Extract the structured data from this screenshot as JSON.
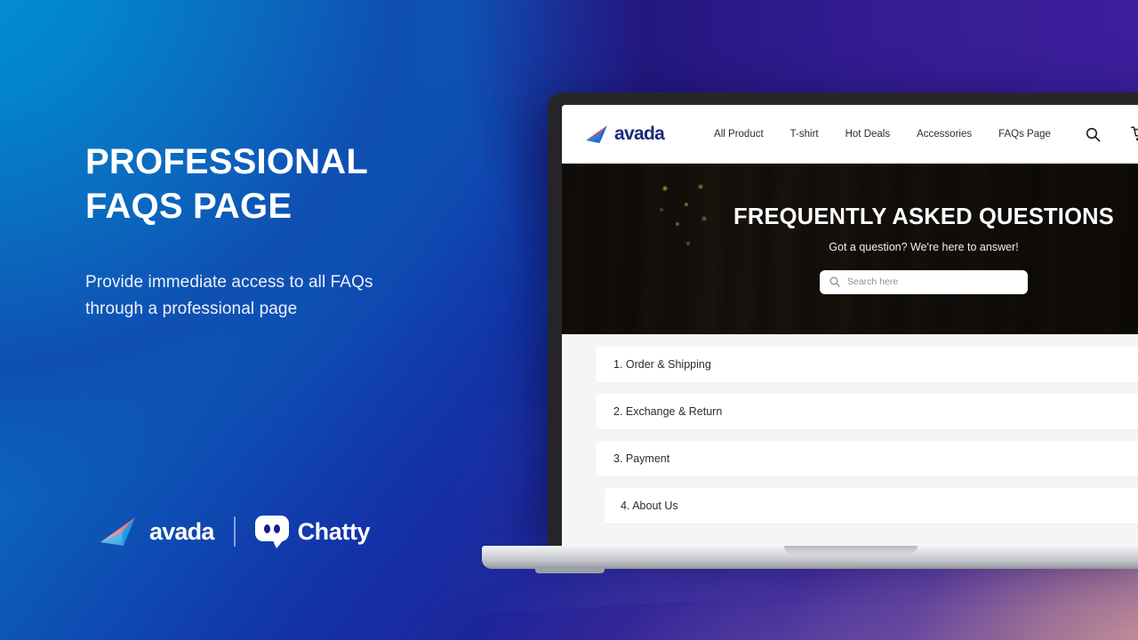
{
  "promo": {
    "headline_line1": "PROFESSIONAL",
    "headline_line2": "FAQs PAGE",
    "subcopy_line1": "Provide immediate access to all FAQs",
    "subcopy_line2": "through a professional page"
  },
  "brands": [
    {
      "name": "avada",
      "mark": "avada-dart-icon"
    },
    {
      "name": "Chatty",
      "mark": "chatty-bubble-icon"
    }
  ],
  "browser": {
    "nav": {
      "logo_text": "avada",
      "links": [
        {
          "label": "All Product"
        },
        {
          "label": "T-shirt"
        },
        {
          "label": "Hot Deals"
        },
        {
          "label": "Accessories"
        },
        {
          "label": "FAQs Page"
        }
      ],
      "icons": [
        {
          "name": "search-icon"
        },
        {
          "name": "cart-icon"
        }
      ]
    },
    "hero": {
      "title": "FREQUENTLY ASKED QUESTIONS",
      "subtitle": "Got a question? We're here to answer!",
      "search_placeholder": "Search here",
      "search_value": ""
    },
    "faqs": [
      {
        "label": "1. Order & Shipping"
      },
      {
        "label": "2. Exchange & Return"
      },
      {
        "label": "3. Payment"
      },
      {
        "label": "4. About Us"
      }
    ]
  },
  "colors": {
    "bg_cyan": "#0093d4",
    "bg_blue": "#0b63bd",
    "bg_indigo": "#1236a9",
    "bg_violet": "#3a2099",
    "bg_glow_warm": "#e0aa9b",
    "brand_navy": "#1b2a7a",
    "page_gray": "#f5f5f5",
    "card_white": "#ffffff"
  }
}
